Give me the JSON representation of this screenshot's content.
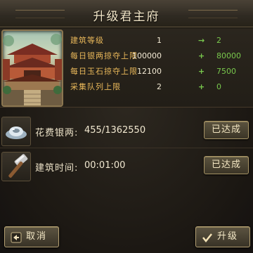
{
  "dialog": {
    "title": "升级君主府"
  },
  "building": {
    "stats": [
      {
        "label": "建筑等级",
        "from": "1",
        "op": "→",
        "to": "2"
      },
      {
        "label": "每日银两掠夺上限",
        "from": "100000",
        "op": "+",
        "to": "80000"
      },
      {
        "label": "每日玉石掠夺上限",
        "from": "12100",
        "op": "+",
        "to": "7500"
      },
      {
        "label": "采集队列上限",
        "from": "2",
        "op": "+",
        "to": "0"
      }
    ]
  },
  "costs": [
    {
      "icon": "silver-ingot-icon",
      "label": "花费银两:",
      "value": "455/1362550",
      "status": "已达成"
    },
    {
      "icon": "hammer-icon",
      "label": "建筑时间:",
      "value": "00:01:00",
      "status": "已达成"
    }
  ],
  "buttons": {
    "cancel": "取消",
    "upgrade": "升级"
  },
  "colors": {
    "stat_label": "#e9b85a",
    "increase": "#79c84d",
    "accent": "#a89566"
  }
}
